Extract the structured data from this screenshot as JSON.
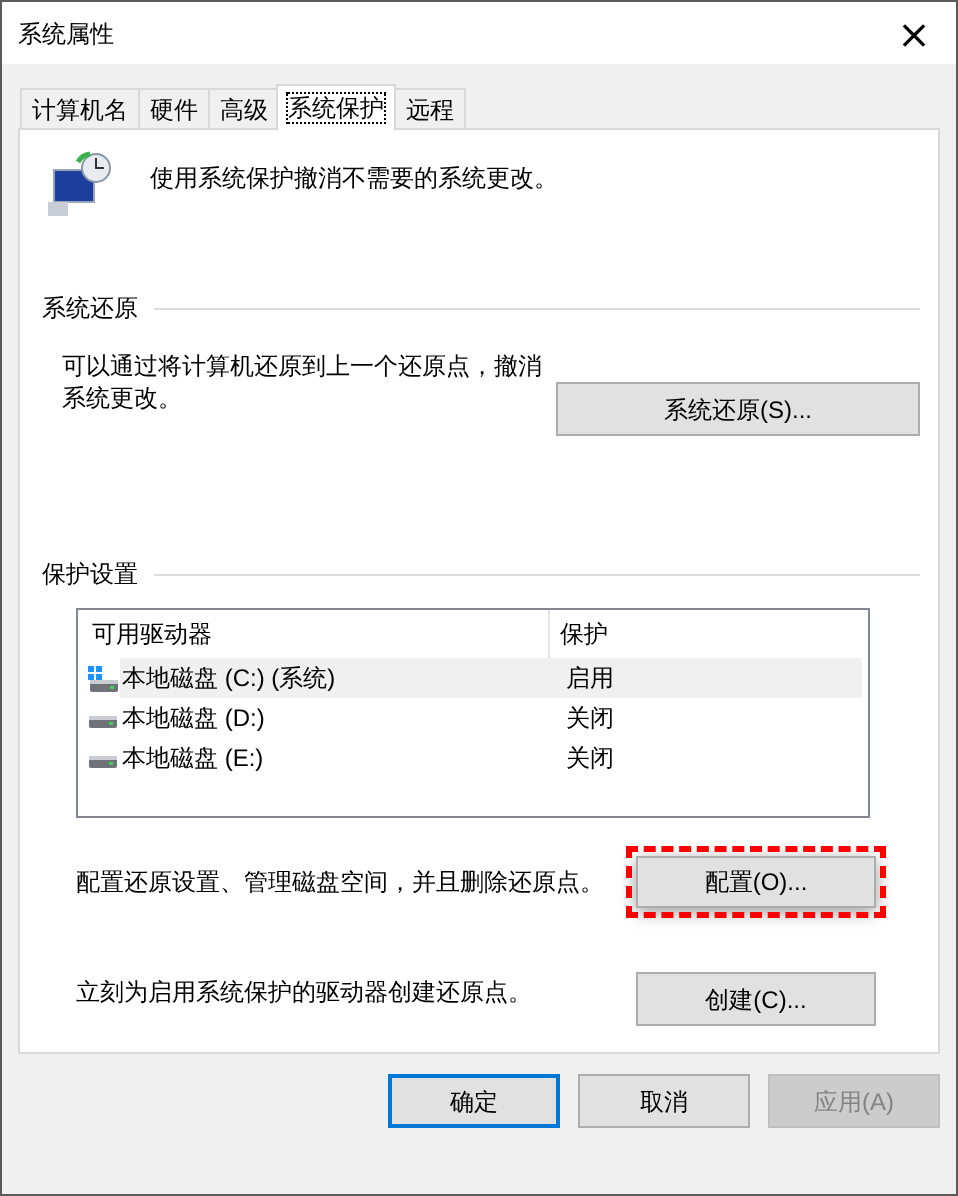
{
  "window": {
    "title": "系统属性",
    "close": "×"
  },
  "tabs": [
    {
      "label": "计算机名",
      "selected": false
    },
    {
      "label": "硬件",
      "selected": false
    },
    {
      "label": "高级",
      "selected": false
    },
    {
      "label": "系统保护",
      "selected": true
    },
    {
      "label": "远程",
      "selected": false
    }
  ],
  "intro": "使用系统保护撤消不需要的系统更改。",
  "restore": {
    "heading": "系统还原",
    "text": "可以通过将计算机还原到上一个还原点，撤消系统更改。",
    "button": "系统还原(S)..."
  },
  "protection": {
    "heading": "保护设置",
    "columns": [
      "可用驱动器",
      "保护"
    ],
    "drives": [
      {
        "name": "本地磁盘 (C:) (系统)",
        "protection": "启用",
        "system": true,
        "selected": true
      },
      {
        "name": "本地磁盘 (D:)",
        "protection": "关闭",
        "system": false,
        "selected": false
      },
      {
        "name": "本地磁盘 (E:)",
        "protection": "关闭",
        "system": false,
        "selected": false
      }
    ],
    "configure": {
      "text": "配置还原设置、管理磁盘空间，并且删除还原点。",
      "button": "配置(O)...",
      "highlighted": true
    },
    "create": {
      "text": "立刻为启用系统保护的驱动器创建还原点。",
      "button": "创建(C)...",
      "highlighted": false
    }
  },
  "buttons": [
    {
      "label": "确定",
      "default": true,
      "disabled": false
    },
    {
      "label": "取消",
      "default": false,
      "disabled": false
    },
    {
      "label": "应用(A)",
      "default": false,
      "disabled": true
    }
  ]
}
